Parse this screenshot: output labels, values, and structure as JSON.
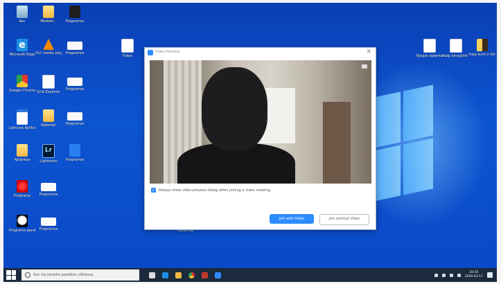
{
  "desktop": {
    "icons": [
      {
        "id": "recycle",
        "label": "Rec",
        "glyph": "g-bin",
        "icon": "recycle-bin-icon"
      },
      {
        "id": "i2",
        "label": "Mediatr...",
        "glyph": "g-folder",
        "icon": "folder-icon"
      },
      {
        "id": "i3",
        "label": "Programos",
        "glyph": "g-dark",
        "icon": "app-icon"
      },
      {
        "id": "edge",
        "label": "Microsoft Edge",
        "glyph": "g-ie",
        "icon": "edge-icon",
        "text": "e"
      },
      {
        "id": "vlc",
        "label": "VLC media player",
        "glyph": "g-vlc",
        "icon": "vlc-icon"
      },
      {
        "id": "i6",
        "label": "Programos",
        "glyph": "g-white",
        "icon": "shortcut-icon"
      },
      {
        "id": "chrome",
        "label": "Google Chrome",
        "glyph": "g-chrome",
        "icon": "chrome-icon"
      },
      {
        "id": "i8",
        "label": "Grid Explorer",
        "glyph": "g-doc",
        "icon": "grid-icon"
      },
      {
        "id": "i9",
        "label": "Programos",
        "glyph": "g-white",
        "icon": "shortcut-icon"
      },
      {
        "id": "i10",
        "label": "Lietuvos Aplikacija",
        "glyph": "g-pdf",
        "icon": "document-icon"
      },
      {
        "id": "i11",
        "label": "Aplankai",
        "glyph": "g-folder",
        "icon": "folder-icon"
      },
      {
        "id": "i12",
        "label": "Programos",
        "glyph": "g-white",
        "icon": "shortcut-icon"
      },
      {
        "id": "i13",
        "label": "Aplankas",
        "glyph": "g-folder",
        "icon": "folder-icon"
      },
      {
        "id": "lr",
        "label": "Lightroom",
        "glyph": "g-lr",
        "icon": "lightroom-icon",
        "text": "Lr"
      },
      {
        "id": "i15",
        "label": "Programos",
        "glyph": "g-blue",
        "icon": "shortcut-icon"
      },
      {
        "id": "i16",
        "label": "Programa",
        "glyph": "g-flower",
        "icon": "flower-icon"
      },
      {
        "id": "i17",
        "label": "Programos",
        "glyph": "g-white",
        "icon": "shortcut-icon"
      },
      {
        "id": "i18",
        "label": "Programa panda",
        "glyph": "g-panda",
        "icon": "panda-icon"
      },
      {
        "id": "i19",
        "label": "Programos",
        "glyph": "g-white",
        "icon": "shortcut-icon"
      },
      {
        "id": "i20",
        "label": "Failas",
        "glyph": "g-doc",
        "icon": "file-icon"
      },
      {
        "id": "i21",
        "label": "Žaidimas",
        "glyph": "g-game",
        "icon": "game-icon"
      },
      {
        "id": "r1",
        "label": "Naujas aplankas",
        "glyph": "g-doc",
        "icon": "file-icon"
      },
      {
        "id": "r2",
        "label": "Kaip atnaujinti Windows",
        "glyph": "g-doc",
        "icon": "document-icon"
      },
      {
        "id": "r3",
        "label": "Kaip kurti ir ištrinti",
        "glyph": "g-zip",
        "icon": "archive-icon"
      }
    ]
  },
  "dialog": {
    "title": "Video Preview",
    "checkbox_label": "Always show video preview dialog when joining a video meeting",
    "checked": true,
    "join_with_video": "Join with Video",
    "join_without_video": "Join without Video",
    "accent": "#2d8cff"
  },
  "taskbar": {
    "search_placeholder": "Sen čia įveskite paieškos užklausą",
    "clock_time": "10:35",
    "clock_date": "2020-03-17"
  }
}
